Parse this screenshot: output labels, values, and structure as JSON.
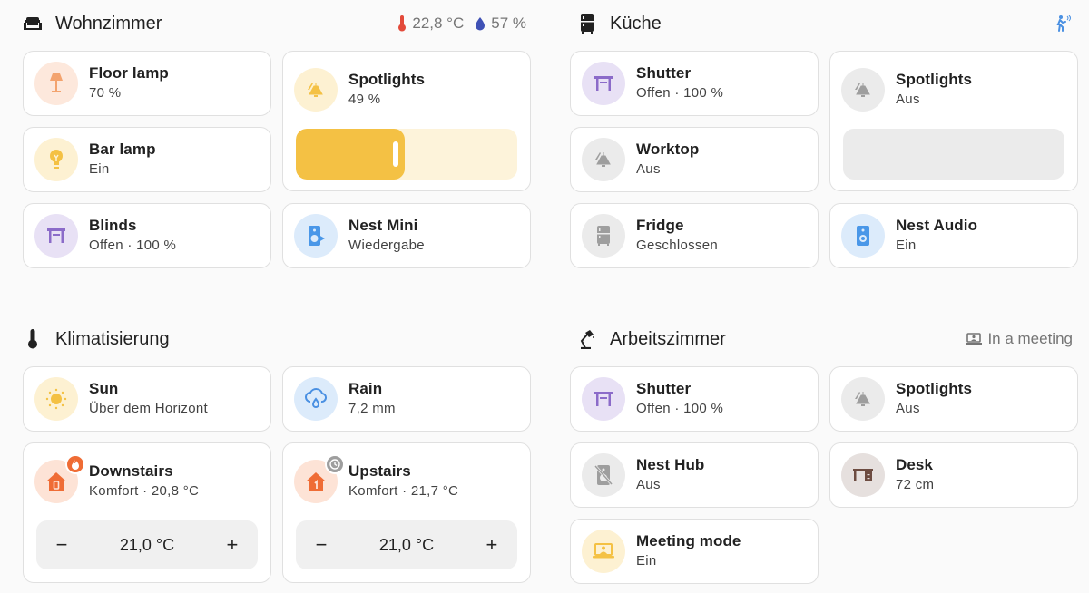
{
  "colors": {
    "background": "#fafafa",
    "light_amber": "#f4c144",
    "orange": "#f18d5c",
    "purple": "#8b6bc9",
    "blue": "#4a97e8",
    "grey": "#9e9e9e",
    "brown": "#795548",
    "heat_orange": "#ef6c35"
  },
  "sections": {
    "wohnzimmer": {
      "title": "Wohnzimmer",
      "icon": "sofa-icon",
      "temperature": "22,8 °C",
      "humidity": "57 %",
      "tiles": [
        {
          "name": "Floor lamp",
          "state": "70 %",
          "icon": "floor-lamp-icon"
        },
        {
          "name": "Spotlights",
          "state": "49 %",
          "icon": "ceiling-light-icon",
          "slider_value_percent": 49
        },
        {
          "name": "Bar lamp",
          "state": "Ein",
          "icon": "lightbulb-icon"
        },
        {
          "name": "Blinds",
          "state": "Offen · 100 %",
          "icon": "blinds-open-icon"
        },
        {
          "name": "Nest Mini",
          "state": "Wiedergabe",
          "icon": "speaker-play-icon"
        }
      ]
    },
    "kueche": {
      "title": "Küche",
      "icon": "fridge-icon",
      "badge_icon": "motion-sensor-icon",
      "tiles": [
        {
          "name": "Shutter",
          "state": "Offen · 100 %",
          "icon": "blinds-open-icon"
        },
        {
          "name": "Spotlights",
          "state": "Aus",
          "icon": "ceiling-light-icon",
          "slider_value_percent": 0
        },
        {
          "name": "Worktop",
          "state": "Aus",
          "icon": "ceiling-light-icon"
        },
        {
          "name": "Fridge",
          "state": "Geschlossen",
          "icon": "fridge-icon"
        },
        {
          "name": "Nest Audio",
          "state": "Ein",
          "icon": "speaker-icon"
        }
      ]
    },
    "klimatisierung": {
      "title": "Klimatisierung",
      "icon": "thermometer-icon",
      "tiles": [
        {
          "name": "Sun",
          "state": "Über dem Horizont",
          "icon": "sun-icon"
        },
        {
          "name": "Rain",
          "state": "7,2 mm",
          "icon": "rain-cloud-icon"
        },
        {
          "name": "Downstairs",
          "state": "Komfort · 20,8 °C",
          "icon": "home-floor-0-icon",
          "badge_icon": "fire-icon",
          "target": "21,0 °C",
          "minus": "−",
          "plus": "+"
        },
        {
          "name": "Upstairs",
          "state": "Komfort · 21,7 °C",
          "icon": "home-floor-1-icon",
          "badge_icon": "clock-icon",
          "target": "21,0 °C",
          "minus": "−",
          "plus": "+"
        }
      ]
    },
    "arbeitszimmer": {
      "title": "Arbeitszimmer",
      "icon": "desk-lamp-icon",
      "badge_text": "In a meeting",
      "badge_icon": "laptop-account-icon",
      "tiles": [
        {
          "name": "Shutter",
          "state": "Offen · 100 %",
          "icon": "blinds-open-icon"
        },
        {
          "name": "Spotlights",
          "state": "Aus",
          "icon": "ceiling-light-icon"
        },
        {
          "name": "Nest Hub",
          "state": "Aus",
          "icon": "speaker-off-icon"
        },
        {
          "name": "Desk",
          "state": "72 cm",
          "icon": "desk-icon"
        },
        {
          "name": "Meeting mode",
          "state": "Ein",
          "icon": "laptop-account-icon"
        }
      ]
    }
  }
}
